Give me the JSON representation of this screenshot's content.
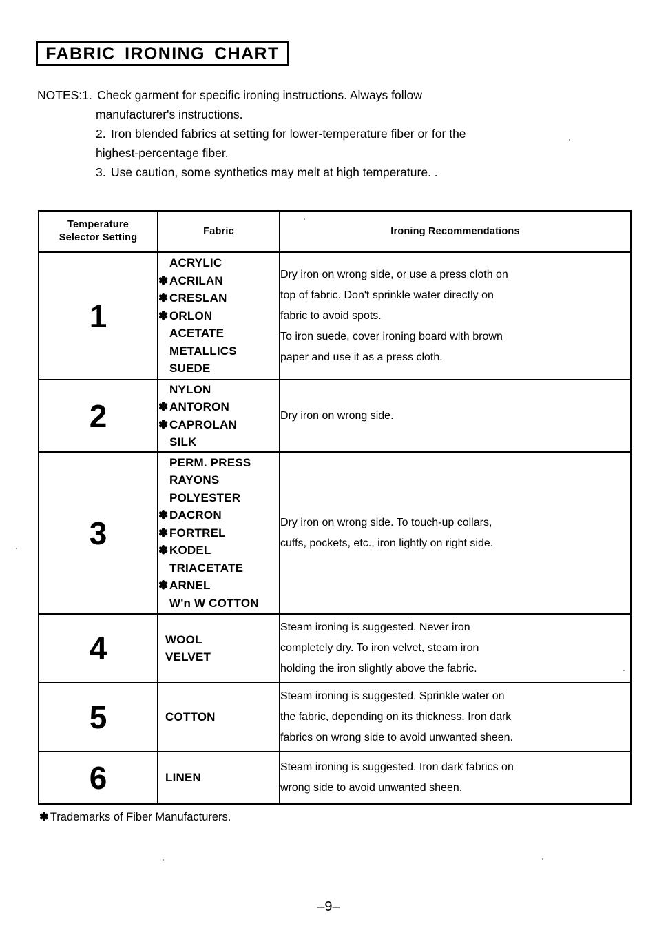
{
  "document": {
    "title": "FABRIC  IRONING  CHART",
    "page_number": "–9–",
    "footnote_star": "✽",
    "footnote_text": "Trademarks of Fiber Manufacturers."
  },
  "notes": {
    "label": "NOTES:",
    "items": [
      {
        "number": "1.",
        "lines": [
          "Check garment for specific ironing instructions. Always follow",
          "manufacturer's instructions."
        ]
      },
      {
        "number": "2.",
        "lines": [
          "Iron blended fabrics at setting for lower-temperature fiber or for the",
          "highest-percentage fiber."
        ]
      },
      {
        "number": "3.",
        "lines": [
          "Use caution, some synthetics may melt at high temperature.  ."
        ]
      }
    ]
  },
  "table": {
    "headers": {
      "setting": "Temperature\nSelector Setting",
      "setting_line1": "Temperature",
      "setting_line2": "Selector Setting",
      "fabric": "Fabric",
      "recommendations": "Ironing Recommendations"
    },
    "rows": [
      {
        "setting": "1",
        "fabrics": [
          {
            "star": "",
            "name": "ACRYLIC"
          },
          {
            "star": "✽",
            "name": "ACRILAN"
          },
          {
            "star": "✽",
            "name": "CRESLAN"
          },
          {
            "star": "✽",
            "name": "ORLON"
          },
          {
            "star": "",
            "name": "ACETATE"
          },
          {
            "star": "",
            "name": "METALLICS"
          },
          {
            "star": "",
            "name": "SUEDE"
          }
        ],
        "recommendation_lines": [
          "Dry iron on wrong side, or use a press cloth on",
          "top of fabric. Don't sprinkle water directly on",
          "fabric to avoid spots.",
          "To iron suede, cover ironing board with brown",
          "paper and use it as a press cloth."
        ]
      },
      {
        "setting": "2",
        "fabrics": [
          {
            "star": "",
            "name": "NYLON"
          },
          {
            "star": "✽",
            "name": "ANTORON"
          },
          {
            "star": "✽",
            "name": "CAPROLAN"
          },
          {
            "star": "",
            "name": "SILK"
          }
        ],
        "recommendation_lines": [
          "Dry iron on wrong side."
        ]
      },
      {
        "setting": "3",
        "fabrics": [
          {
            "star": "",
            "name": "PERM.  PRESS"
          },
          {
            "star": "",
            "name": "RAYONS"
          },
          {
            "star": "",
            "name": "POLYESTER"
          },
          {
            "star": "✽",
            "name": "DACRON"
          },
          {
            "star": "✽",
            "name": "FORTREL"
          },
          {
            "star": "✽",
            "name": "KODEL"
          },
          {
            "star": "",
            "name": "TRIACETATE"
          },
          {
            "star": "✽",
            "name": "ARNEL"
          },
          {
            "star": "",
            "name": "W'n W COTTON"
          }
        ],
        "recommendation_lines": [
          "Dry iron on wrong side. To touch-up collars,",
          "cuffs, pockets, etc., iron lightly on right side."
        ]
      },
      {
        "setting": "4",
        "fabrics": [
          {
            "star": "",
            "name": "WOOL"
          },
          {
            "star": "",
            "name": "VELVET"
          }
        ],
        "recommendation_lines": [
          "Steam ironing is suggested. Never iron",
          "completely dry. To iron velvet, steam iron",
          "holding the iron slightly above the fabric."
        ]
      },
      {
        "setting": "5",
        "fabrics": [
          {
            "star": "",
            "name": "COTTON"
          }
        ],
        "recommendation_lines": [
          "Steam ironing is suggested. Sprinkle water on",
          "the fabric, depending on its thickness. Iron dark",
          "fabrics on wrong side to avoid unwanted sheen."
        ]
      },
      {
        "setting": "6",
        "fabrics": [
          {
            "star": "",
            "name": "LINEN"
          }
        ],
        "recommendation_lines": [
          "Steam ironing is suggested. Iron dark fabrics on",
          "wrong side to avoid unwanted sheen."
        ]
      }
    ]
  }
}
